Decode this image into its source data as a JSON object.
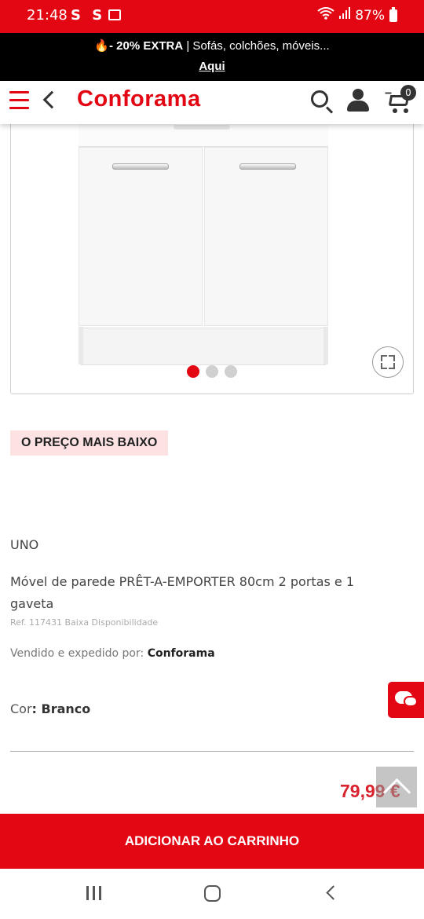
{
  "statusbar": {
    "time": "21:48",
    "notif_icons": "S S",
    "battery": "87%",
    "colors": {
      "bar": "#e30613"
    },
    "icons": [
      "s-icon",
      "s-icon",
      "image-icon",
      "wifi-icon",
      "signal-icon",
      "battery-icon"
    ]
  },
  "promo": {
    "fire": "🔥",
    "bold": "- 20% EXTRA",
    "text": " | Sofás, colchões, móveis...",
    "link": "Aqui"
  },
  "header": {
    "logo": "Conforama",
    "cart_count": "0",
    "brand_color": "#e30613",
    "icons": [
      "hamburger-icon",
      "back-chevron-icon",
      "search-icon",
      "user-icon",
      "cart-icon"
    ]
  },
  "gallery": {
    "slides_total": 3,
    "active_slide": 1
  },
  "product": {
    "badge": "O PREÇO MAIS BAIXO",
    "brand": "UNO",
    "title": "Móvel de parede PRÊT-A-EMPORTER 80cm 2 portas e 1 gaveta",
    "ref": "Ref. 117431 Baixa Disponibilidade",
    "seller_label": "Vendido e expedido por: ",
    "seller_name": "Conforama",
    "color_label": "Cor",
    "color_value": ": Branco",
    "price": "79,99 €",
    "price_color": "#d9232e"
  },
  "cta": {
    "label": "ADICIONAR AO CARRINHO"
  },
  "navbar": {
    "icons": [
      "recents-icon",
      "home-icon",
      "back-icon"
    ]
  }
}
